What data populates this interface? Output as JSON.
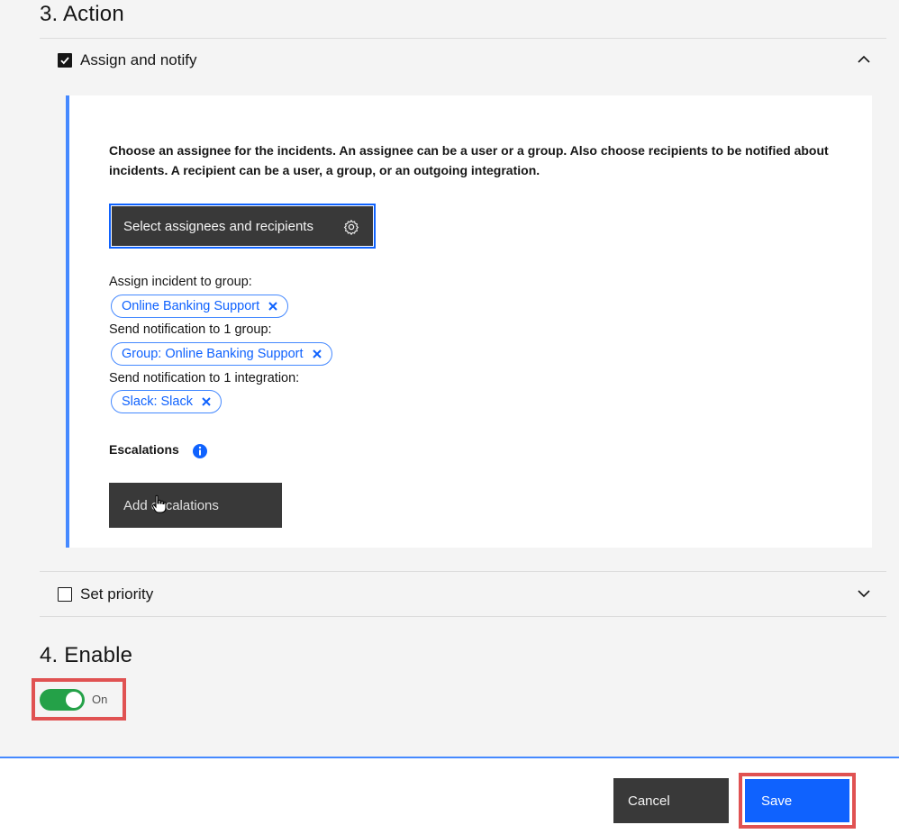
{
  "action_section": {
    "title": "3. Action",
    "assign_notify": {
      "label": "Assign and notify",
      "checked": true,
      "expanded": true,
      "description": "Choose an assignee for the incidents. An assignee can be a user or a group. Also choose recipients to be notified about incidents. A recipient can be a user, a group, or an outgoing integration.",
      "select_button_label": "Select assignees and recipients",
      "assign_group_label": "Assign incident to group:",
      "assign_group_tag": "Online Banking Support",
      "notify_group_label": "Send notification to 1 group:",
      "notify_group_tag": "Group: Online Banking Support",
      "notify_integration_label": "Send notification to 1 integration:",
      "notify_integration_tag": "Slack: Slack",
      "escalations_label": "Escalations",
      "add_escalations_label": "Add escalations"
    },
    "set_priority": {
      "label": "Set priority",
      "checked": false,
      "expanded": false
    }
  },
  "enable_section": {
    "title": "4. Enable",
    "toggle_label": "On",
    "toggle_on": true
  },
  "footer": {
    "cancel_label": "Cancel",
    "save_label": "Save"
  },
  "colors": {
    "accent": "#0f62fe",
    "toggle_on": "#24a148",
    "highlight": "#e05252",
    "panel_border": "#4589ff"
  }
}
